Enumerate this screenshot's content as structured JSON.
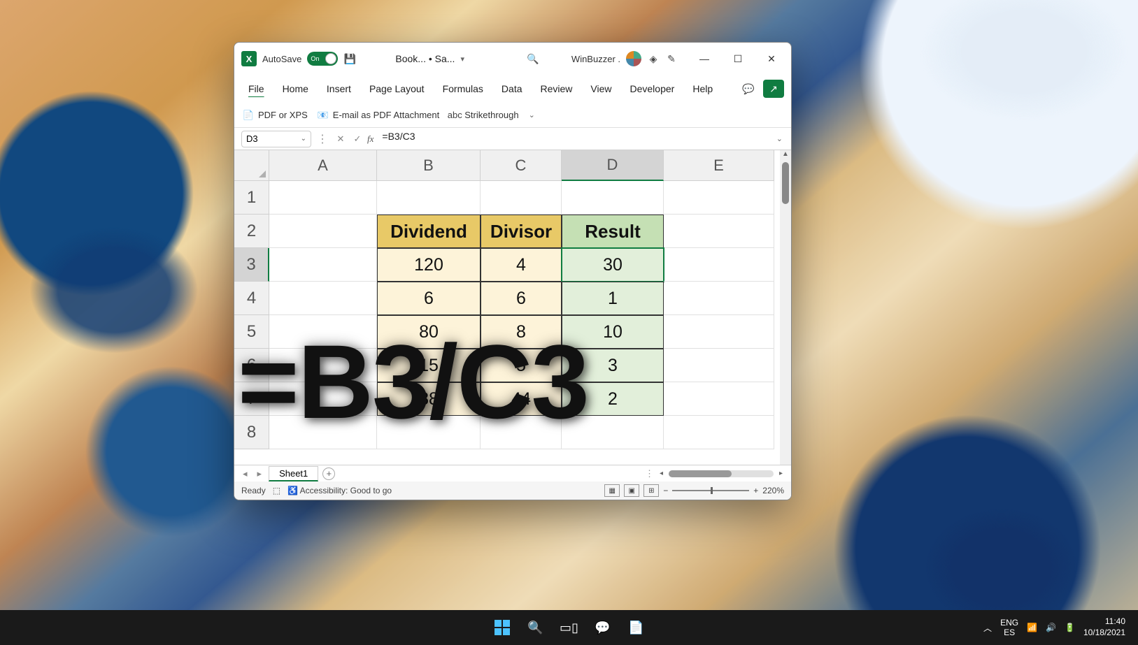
{
  "title_bar": {
    "autosave_label": "AutoSave",
    "autosave_state": "On",
    "doc_name": "Book... • Sa...",
    "user_name": "WinBuzzer ."
  },
  "ribbon": {
    "tabs": [
      "File",
      "Home",
      "Insert",
      "Page Layout",
      "Formulas",
      "Data",
      "Review",
      "View",
      "Developer",
      "Help"
    ]
  },
  "qat": {
    "pdf": "PDF or XPS",
    "email": "E-mail as PDF Attachment",
    "strike": "Strikethrough"
  },
  "formula_bar": {
    "name_box": "D3",
    "formula": "=B3/C3"
  },
  "columns": [
    "A",
    "B",
    "C",
    "D",
    "E"
  ],
  "rows": [
    "1",
    "2",
    "3",
    "4",
    "5",
    "6",
    "7",
    "8"
  ],
  "table": {
    "headers": {
      "b": "Dividend",
      "c": "Divisor",
      "d": "Result"
    },
    "data": [
      {
        "b": "120",
        "c": "4",
        "d": "30"
      },
      {
        "b": "6",
        "c": "6",
        "d": "1"
      },
      {
        "b": "80",
        "c": "8",
        "d": "10"
      },
      {
        "b": "15",
        "c": "5",
        "d": "3"
      },
      {
        "b": "88",
        "c": "44",
        "d": "2"
      }
    ]
  },
  "sheet_tab": "Sheet1",
  "status": {
    "ready": "Ready",
    "accessibility": "Accessibility: Good to go",
    "zoom": "220%"
  },
  "overlay": "=B3/C3",
  "taskbar": {
    "lang1": "ENG",
    "lang2": "ES",
    "time": "11:40",
    "date": "10/18/2021"
  }
}
